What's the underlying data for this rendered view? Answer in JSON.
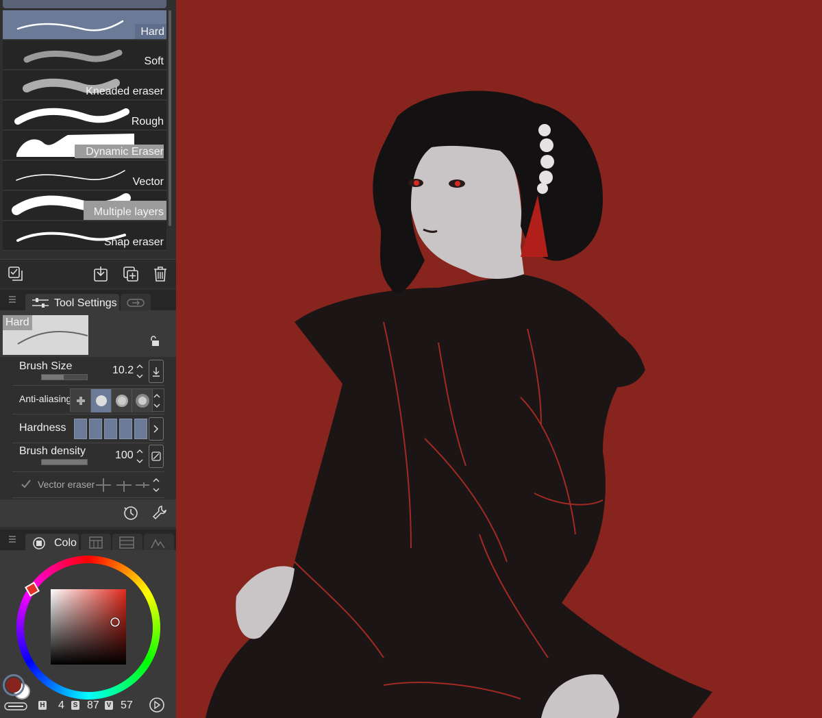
{
  "brushes": [
    {
      "label": "Hard",
      "selected": true
    },
    {
      "label": "Soft",
      "selected": false
    },
    {
      "label": "Kneaded eraser",
      "selected": false
    },
    {
      "label": "Rough",
      "selected": false
    },
    {
      "label": "Dynamic Eraser",
      "selected": false
    },
    {
      "label": "Vector",
      "selected": false
    },
    {
      "label": "Multiple layers",
      "selected": false
    },
    {
      "label": "Snap eraser",
      "selected": false
    }
  ],
  "tool_settings": {
    "tab_label": "Tool Settings",
    "preview_label": "Hard",
    "brush_size": {
      "label": "Brush Size",
      "value": "10.2"
    },
    "anti_aliasing": {
      "label": "Anti-aliasing",
      "selected_level": 1
    },
    "hardness": {
      "label": "Hardness",
      "level": 5
    },
    "brush_density": {
      "label": "Brush density",
      "value": "100"
    },
    "vector_eraser": {
      "label": "Vector eraser",
      "checked": true
    }
  },
  "color": {
    "tab_label": "Colo",
    "main_color": "#86241d",
    "sub_color": "#ffffff",
    "h_label": "H",
    "h": "4",
    "s_label": "S",
    "s": "87",
    "v_label": "V",
    "v": "57"
  },
  "icons": {
    "brush_list_bar": [
      "select-all-icon",
      "import-icon",
      "duplicate-icon",
      "trash-icon"
    ],
    "tool_bottom": [
      "reset-icon",
      "wrench-icon"
    ],
    "color_tabs": [
      "color-wheel-icon",
      "color-set-icon",
      "color-slider-icon",
      "color-history-icon"
    ]
  },
  "theme": {
    "canvas_bg": "#86241d",
    "accent": "#6b7a96",
    "panel": "#3a3a3a"
  }
}
